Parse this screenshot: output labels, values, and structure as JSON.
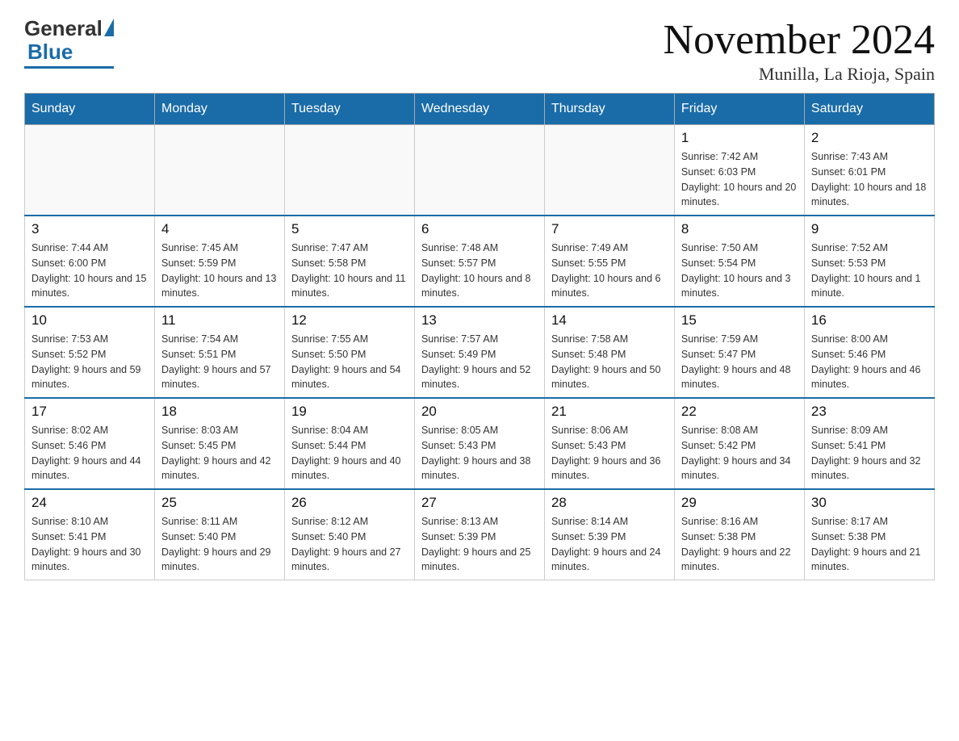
{
  "header": {
    "logo_general": "General",
    "logo_blue": "Blue",
    "month_title": "November 2024",
    "location": "Munilla, La Rioja, Spain"
  },
  "days_of_week": [
    "Sunday",
    "Monday",
    "Tuesday",
    "Wednesday",
    "Thursday",
    "Friday",
    "Saturday"
  ],
  "weeks": [
    [
      {
        "day": "",
        "sunrise": "",
        "sunset": "",
        "daylight": ""
      },
      {
        "day": "",
        "sunrise": "",
        "sunset": "",
        "daylight": ""
      },
      {
        "day": "",
        "sunrise": "",
        "sunset": "",
        "daylight": ""
      },
      {
        "day": "",
        "sunrise": "",
        "sunset": "",
        "daylight": ""
      },
      {
        "day": "",
        "sunrise": "",
        "sunset": "",
        "daylight": ""
      },
      {
        "day": "1",
        "sunrise": "Sunrise: 7:42 AM",
        "sunset": "Sunset: 6:03 PM",
        "daylight": "Daylight: 10 hours and 20 minutes."
      },
      {
        "day": "2",
        "sunrise": "Sunrise: 7:43 AM",
        "sunset": "Sunset: 6:01 PM",
        "daylight": "Daylight: 10 hours and 18 minutes."
      }
    ],
    [
      {
        "day": "3",
        "sunrise": "Sunrise: 7:44 AM",
        "sunset": "Sunset: 6:00 PM",
        "daylight": "Daylight: 10 hours and 15 minutes."
      },
      {
        "day": "4",
        "sunrise": "Sunrise: 7:45 AM",
        "sunset": "Sunset: 5:59 PM",
        "daylight": "Daylight: 10 hours and 13 minutes."
      },
      {
        "day": "5",
        "sunrise": "Sunrise: 7:47 AM",
        "sunset": "Sunset: 5:58 PM",
        "daylight": "Daylight: 10 hours and 11 minutes."
      },
      {
        "day": "6",
        "sunrise": "Sunrise: 7:48 AM",
        "sunset": "Sunset: 5:57 PM",
        "daylight": "Daylight: 10 hours and 8 minutes."
      },
      {
        "day": "7",
        "sunrise": "Sunrise: 7:49 AM",
        "sunset": "Sunset: 5:55 PM",
        "daylight": "Daylight: 10 hours and 6 minutes."
      },
      {
        "day": "8",
        "sunrise": "Sunrise: 7:50 AM",
        "sunset": "Sunset: 5:54 PM",
        "daylight": "Daylight: 10 hours and 3 minutes."
      },
      {
        "day": "9",
        "sunrise": "Sunrise: 7:52 AM",
        "sunset": "Sunset: 5:53 PM",
        "daylight": "Daylight: 10 hours and 1 minute."
      }
    ],
    [
      {
        "day": "10",
        "sunrise": "Sunrise: 7:53 AM",
        "sunset": "Sunset: 5:52 PM",
        "daylight": "Daylight: 9 hours and 59 minutes."
      },
      {
        "day": "11",
        "sunrise": "Sunrise: 7:54 AM",
        "sunset": "Sunset: 5:51 PM",
        "daylight": "Daylight: 9 hours and 57 minutes."
      },
      {
        "day": "12",
        "sunrise": "Sunrise: 7:55 AM",
        "sunset": "Sunset: 5:50 PM",
        "daylight": "Daylight: 9 hours and 54 minutes."
      },
      {
        "day": "13",
        "sunrise": "Sunrise: 7:57 AM",
        "sunset": "Sunset: 5:49 PM",
        "daylight": "Daylight: 9 hours and 52 minutes."
      },
      {
        "day": "14",
        "sunrise": "Sunrise: 7:58 AM",
        "sunset": "Sunset: 5:48 PM",
        "daylight": "Daylight: 9 hours and 50 minutes."
      },
      {
        "day": "15",
        "sunrise": "Sunrise: 7:59 AM",
        "sunset": "Sunset: 5:47 PM",
        "daylight": "Daylight: 9 hours and 48 minutes."
      },
      {
        "day": "16",
        "sunrise": "Sunrise: 8:00 AM",
        "sunset": "Sunset: 5:46 PM",
        "daylight": "Daylight: 9 hours and 46 minutes."
      }
    ],
    [
      {
        "day": "17",
        "sunrise": "Sunrise: 8:02 AM",
        "sunset": "Sunset: 5:46 PM",
        "daylight": "Daylight: 9 hours and 44 minutes."
      },
      {
        "day": "18",
        "sunrise": "Sunrise: 8:03 AM",
        "sunset": "Sunset: 5:45 PM",
        "daylight": "Daylight: 9 hours and 42 minutes."
      },
      {
        "day": "19",
        "sunrise": "Sunrise: 8:04 AM",
        "sunset": "Sunset: 5:44 PM",
        "daylight": "Daylight: 9 hours and 40 minutes."
      },
      {
        "day": "20",
        "sunrise": "Sunrise: 8:05 AM",
        "sunset": "Sunset: 5:43 PM",
        "daylight": "Daylight: 9 hours and 38 minutes."
      },
      {
        "day": "21",
        "sunrise": "Sunrise: 8:06 AM",
        "sunset": "Sunset: 5:43 PM",
        "daylight": "Daylight: 9 hours and 36 minutes."
      },
      {
        "day": "22",
        "sunrise": "Sunrise: 8:08 AM",
        "sunset": "Sunset: 5:42 PM",
        "daylight": "Daylight: 9 hours and 34 minutes."
      },
      {
        "day": "23",
        "sunrise": "Sunrise: 8:09 AM",
        "sunset": "Sunset: 5:41 PM",
        "daylight": "Daylight: 9 hours and 32 minutes."
      }
    ],
    [
      {
        "day": "24",
        "sunrise": "Sunrise: 8:10 AM",
        "sunset": "Sunset: 5:41 PM",
        "daylight": "Daylight: 9 hours and 30 minutes."
      },
      {
        "day": "25",
        "sunrise": "Sunrise: 8:11 AM",
        "sunset": "Sunset: 5:40 PM",
        "daylight": "Daylight: 9 hours and 29 minutes."
      },
      {
        "day": "26",
        "sunrise": "Sunrise: 8:12 AM",
        "sunset": "Sunset: 5:40 PM",
        "daylight": "Daylight: 9 hours and 27 minutes."
      },
      {
        "day": "27",
        "sunrise": "Sunrise: 8:13 AM",
        "sunset": "Sunset: 5:39 PM",
        "daylight": "Daylight: 9 hours and 25 minutes."
      },
      {
        "day": "28",
        "sunrise": "Sunrise: 8:14 AM",
        "sunset": "Sunset: 5:39 PM",
        "daylight": "Daylight: 9 hours and 24 minutes."
      },
      {
        "day": "29",
        "sunrise": "Sunrise: 8:16 AM",
        "sunset": "Sunset: 5:38 PM",
        "daylight": "Daylight: 9 hours and 22 minutes."
      },
      {
        "day": "30",
        "sunrise": "Sunrise: 8:17 AM",
        "sunset": "Sunset: 5:38 PM",
        "daylight": "Daylight: 9 hours and 21 minutes."
      }
    ]
  ]
}
